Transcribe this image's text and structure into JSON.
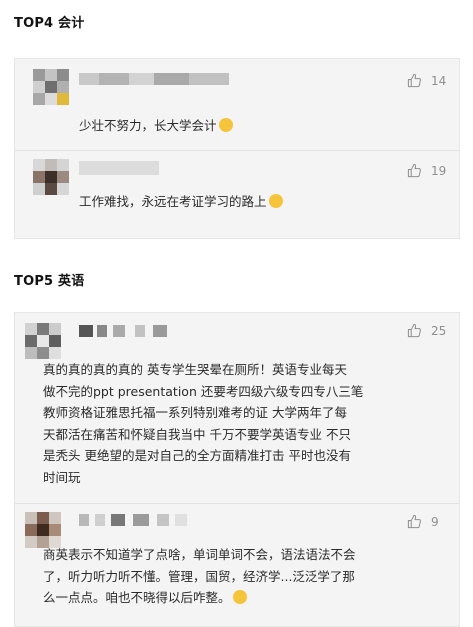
{
  "sections": [
    {
      "title": "TOP4 会计",
      "comments": [
        {
          "likes": "14",
          "text": "少壮不努力，长大学会计",
          "emoji": "smile-emoji"
        },
        {
          "likes": "19",
          "text": "工作难找，永远在考证学习的路上",
          "emoji": "crying-emoji"
        }
      ]
    },
    {
      "title": "TOP5 英语",
      "comments": [
        {
          "likes": "25",
          "text": "真的真的真的真的 英专学生哭晕在厕所！英语专业每天\n做不完的ppt presentation 还要考四级六级专四专八三笔\n教师资格证雅思托福一系列特别难考的证 大学两年了每\n天都活在痛苦和怀疑自我当中 千万不要学英语专业 不只\n是秃头 更绝望的是对自己的全方面精准打击 平时也没有\n时间玩",
          "emoji": ""
        },
        {
          "likes": "9",
          "text": "商英表示不知道学了点啥，单词单词不会，语法语法不会\n了，听力听力听不懂。管理，国贸，经济学...泛泛学了那\n么一点点。咱也不晓得以后咋整。",
          "emoji": "facepalm-emoji"
        }
      ]
    }
  ],
  "colors": {
    "card_bg": "#f4f4f4",
    "text": "#2b2b2b",
    "muted": "#8f8f8f"
  }
}
